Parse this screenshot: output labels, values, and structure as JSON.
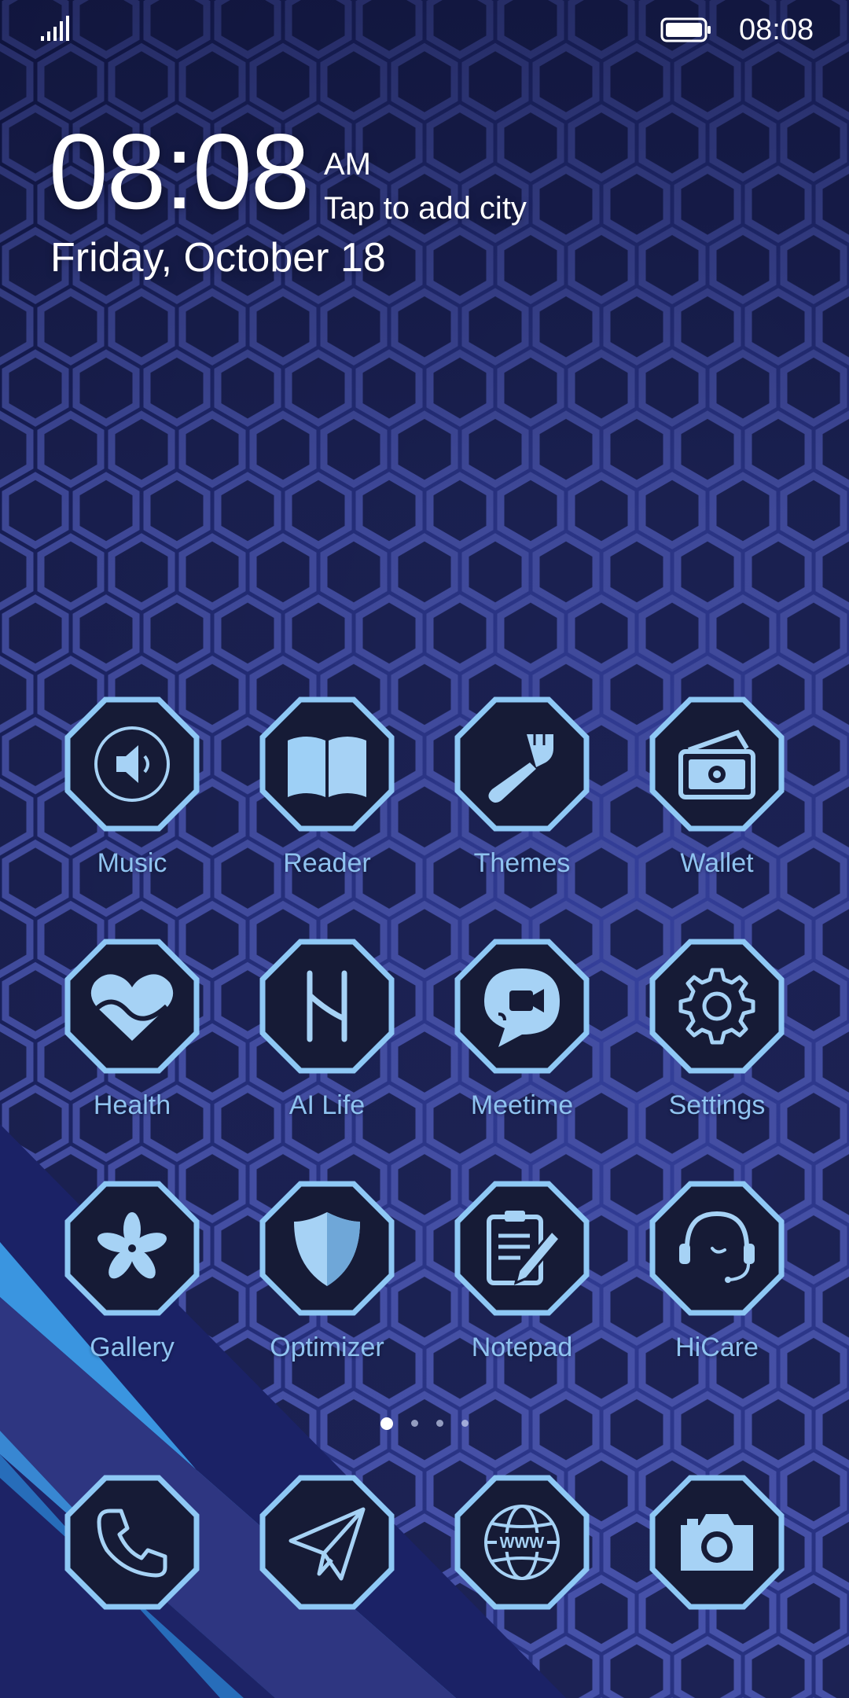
{
  "status_bar": {
    "time": "08:08",
    "signal_icon": "signal-bars-icon",
    "battery_icon": "battery-full-icon"
  },
  "clock_widget": {
    "time": "08:08",
    "ampm": "AM",
    "city_prompt": "Tap to add city",
    "date": "Friday, October 18"
  },
  "apps": [
    {
      "label": "Music",
      "icon": "speaker-icon"
    },
    {
      "label": "Reader",
      "icon": "book-icon"
    },
    {
      "label": "Themes",
      "icon": "paintbrush-icon"
    },
    {
      "label": "Wallet",
      "icon": "wallet-icon"
    },
    {
      "label": "Health",
      "icon": "heart-icon"
    },
    {
      "label": "AI Life",
      "icon": "ai-life-icon"
    },
    {
      "label": "Meetime",
      "icon": "video-chat-icon"
    },
    {
      "label": "Settings",
      "icon": "gear-icon"
    },
    {
      "label": "Gallery",
      "icon": "flower-icon"
    },
    {
      "label": "Optimizer",
      "icon": "shield-icon"
    },
    {
      "label": "Notepad",
      "icon": "notepad-icon"
    },
    {
      "label": "HiCare",
      "icon": "headset-icon"
    }
  ],
  "page_indicator": {
    "page_count": 4,
    "active_page": 1
  },
  "dock": [
    {
      "name": "phone",
      "icon": "phone-icon"
    },
    {
      "name": "messages",
      "icon": "paper-plane-icon"
    },
    {
      "name": "browser",
      "icon": "globe-icon",
      "icon_text": "WWW"
    },
    {
      "name": "camera",
      "icon": "camera-icon"
    }
  ],
  "colors": {
    "background": "#1f2a6b",
    "hex_grid_line": "#5560b8",
    "icon_border": "#8ec8f5",
    "icon_fill": "#161b36",
    "icon_glyph": "#a6d2f5",
    "label": "#8fc3f0",
    "accent_stripe": "#3a95e0"
  }
}
